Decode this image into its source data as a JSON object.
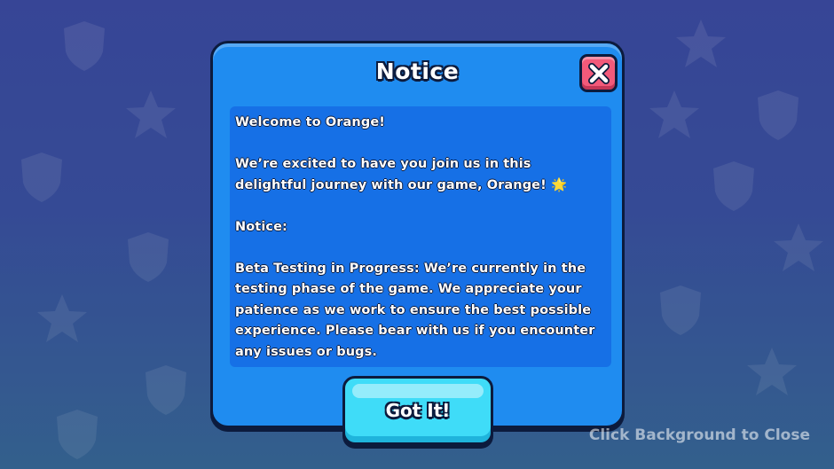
{
  "dialog": {
    "title": "Notice",
    "close_icon": "close-x-icon",
    "content": {
      "greeting": "Welcome to Orange!",
      "intro": "We’re excited to have you join us in this delightful journey with our game, Orange!",
      "intro_emoji": "🌟",
      "notice_heading": "Notice:",
      "beta_text": "Beta Testing in Progress: We’re currently in the testing phase of the game. We appreciate your patience as we work to ensure the best possible experience. Please bear with us if you encounter any issues or bugs."
    },
    "confirm_label": "Got It!"
  },
  "hint": "Click Background to Close",
  "colors": {
    "dialog_blue": "#1f8cf0",
    "content_blue": "#1670e6",
    "close_red": "#f25a7a",
    "button_cyan": "#3fdcf8",
    "outline": "#0c1b3d"
  },
  "background_icons": [
    "shield-icon",
    "star-icon",
    "lightning-icon"
  ]
}
